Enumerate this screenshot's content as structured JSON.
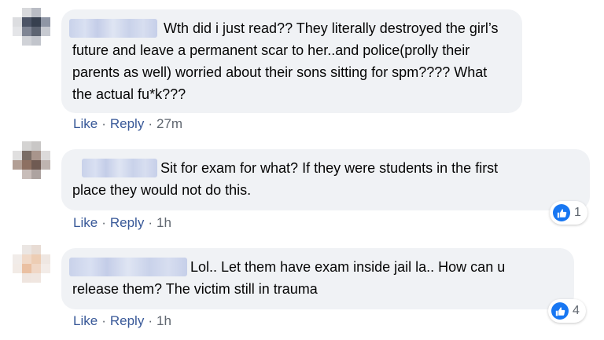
{
  "colors": {
    "link": "#385898",
    "bubble": "#f0f2f5",
    "like_blue": "#1877f2",
    "meta": "#606770"
  },
  "comments": [
    {
      "lines": [
        "Wth did i just read?? They literally destroyed the girl’s",
        "future and leave a permanent scar to her..and police(prolly their",
        "parents as well) worried about their sons sitting for spm???? What",
        "the actual fu*k???"
      ],
      "like_label": "Like",
      "reply_label": "Reply",
      "separator": "·",
      "time": "27m",
      "reaction_icon": "thumbs-up-icon",
      "reaction_count": null
    },
    {
      "lines": [
        "Sit for exam for what? If they were students in the first",
        "place they would not do this."
      ],
      "like_label": "Like",
      "reply_label": "Reply",
      "separator": "·",
      "time": "1h",
      "reaction_icon": "thumbs-up-icon",
      "reaction_count": "1"
    },
    {
      "lines": [
        "Lol.. Let them have exam inside jail la.. How can u",
        "release them? The victim still in trauma"
      ],
      "like_label": "Like",
      "reply_label": "Reply",
      "separator": "·",
      "time": "1h",
      "reaction_icon": "thumbs-up-icon",
      "reaction_count": "4"
    }
  ]
}
